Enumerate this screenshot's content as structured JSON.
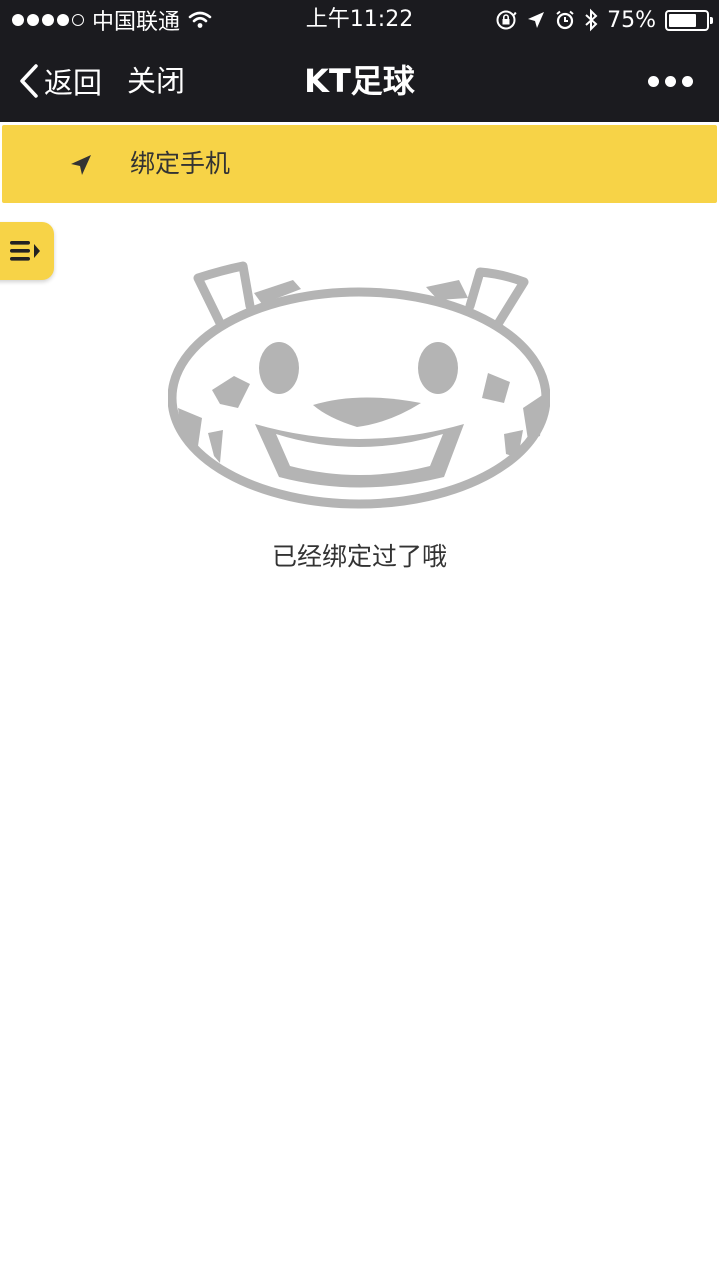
{
  "status_bar": {
    "carrier": "中国联通",
    "time": "上午11:22",
    "battery": "75%",
    "battery_level": 0.75,
    "icons": [
      "signal-dots-icon",
      "wifi-icon",
      "orientation-lock-icon",
      "location-arrow-icon",
      "alarm-icon",
      "bluetooth-icon",
      "battery-icon"
    ]
  },
  "nav": {
    "back_label": "返回",
    "close_label": "关闭",
    "title": "KT足球",
    "more_icon": "more-dots-icon"
  },
  "bind_bar": {
    "icon": "location-arrow-icon",
    "label": "绑定手机"
  },
  "side_tab": {
    "icon": "menu-toggle-icon"
  },
  "empty_state": {
    "image": "tiger-mascot-illustration",
    "message": "已经绑定过了哦"
  },
  "colors": {
    "header_bg": "#1b1b1f",
    "accent_yellow": "#f7d347",
    "mascot_gray": "#b4b4b4",
    "text_dark": "#333333"
  }
}
